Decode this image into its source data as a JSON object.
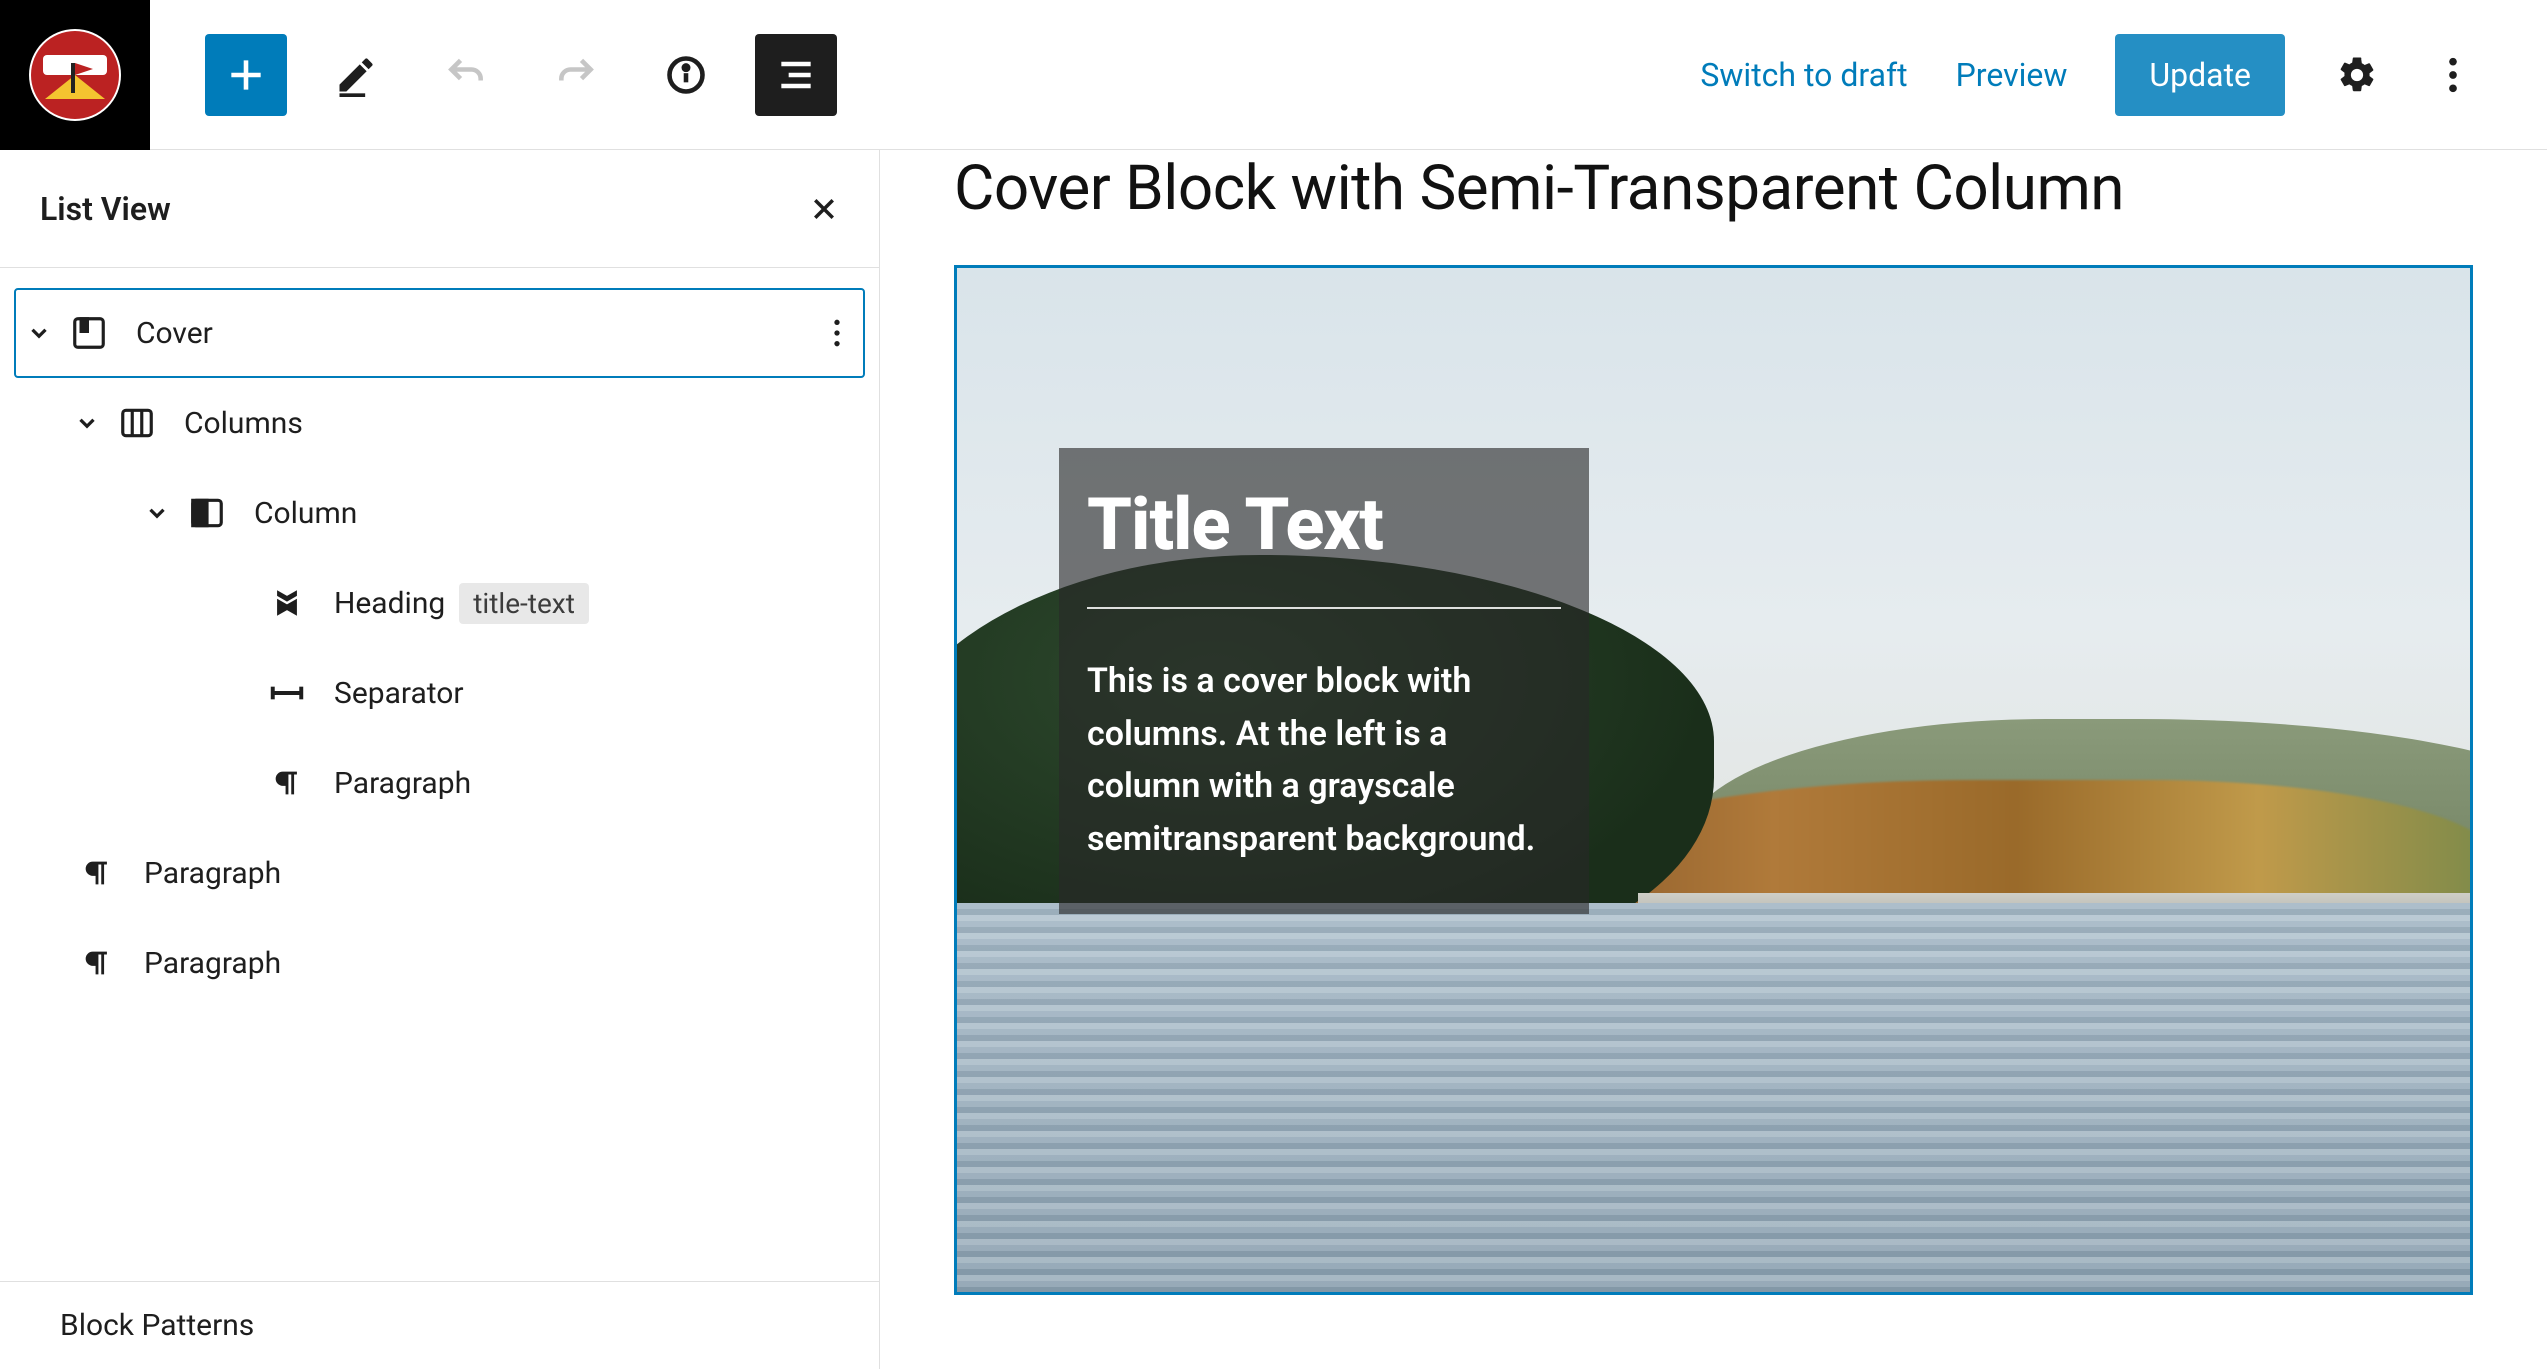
{
  "topbar": {
    "switch_draft": "Switch to draft",
    "preview": "Preview",
    "update": "Update"
  },
  "sidebar": {
    "title": "List View",
    "footer": "Block Patterns",
    "tree": [
      {
        "label": "Cover"
      },
      {
        "label": "Columns"
      },
      {
        "label": "Column"
      },
      {
        "label": "Heading",
        "tag": "title-text"
      },
      {
        "label": "Separator"
      },
      {
        "label": "Paragraph"
      },
      {
        "label": "Paragraph"
      },
      {
        "label": "Paragraph"
      }
    ]
  },
  "page": {
    "title": "Cover Block with Semi-Transparent Column"
  },
  "cover": {
    "heading": "Title Text",
    "paragraph": "This is a cover block with columns. At the left is a column with a grayscale semitransparent background."
  }
}
